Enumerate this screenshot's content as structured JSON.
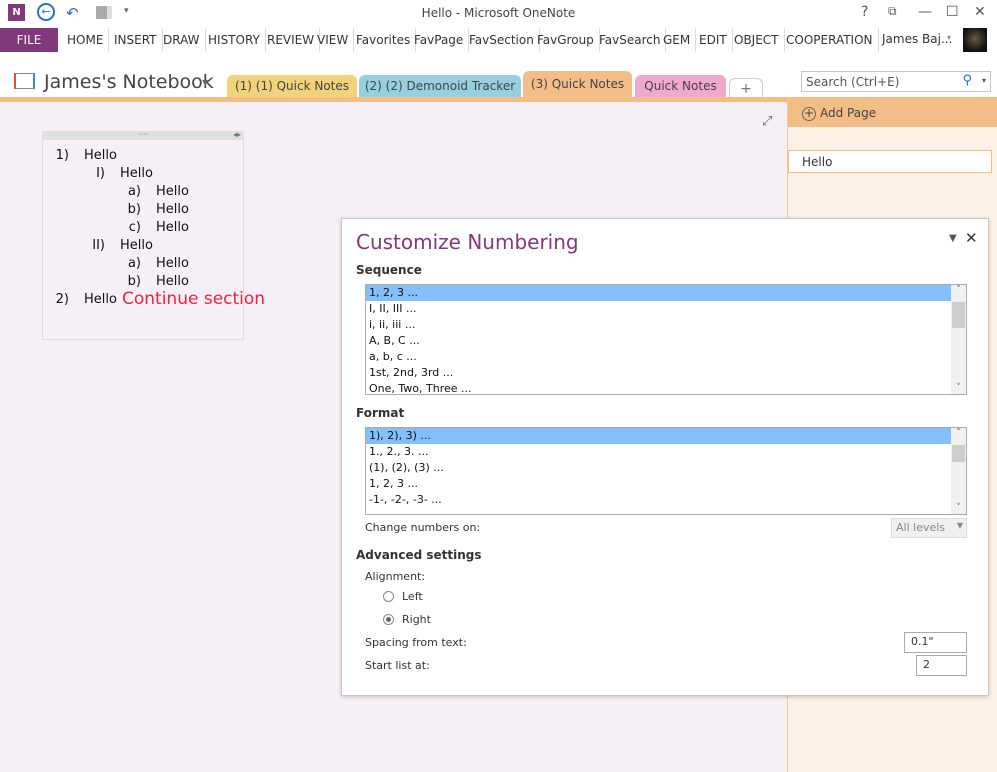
{
  "window": {
    "title": "Hello - Microsoft OneNote",
    "help": "?",
    "restore": "⧉",
    "minimize": "—",
    "maximize": "☐",
    "close": "✕"
  },
  "quick_access": {
    "app_icon": "onenote-icon",
    "back_icon": "back-icon",
    "undo_icon": "undo-icon",
    "dock_icon": "dock-icon",
    "customize": "▾"
  },
  "ribbon": {
    "tabs": [
      "FILE",
      "HOME",
      "INSERT",
      "DRAW",
      "HISTORY",
      "REVIEW",
      "VIEW",
      "Favorites",
      "FavPage",
      "FavSection",
      "FavGroup",
      "FavSearch",
      "GEM",
      "EDIT",
      "OBJECT",
      "COOPERATION"
    ],
    "user": "James Baj...",
    "user_caret": "▾"
  },
  "notebook": {
    "name": "James's Notebook",
    "caret": "▾"
  },
  "sections": [
    {
      "label": "(1) (1) Quick Notes",
      "color": "#f2d27a"
    },
    {
      "label": "(2) (2) Demonoid Tracker",
      "color": "#95cfe0"
    },
    {
      "label": "(3) Quick Notes",
      "color": "#f3bd87",
      "active": true
    },
    {
      "label": "Quick Notes",
      "color": "#f0a8d0"
    },
    {
      "label": "+"
    }
  ],
  "search": {
    "placeholder": "Search (Ctrl+E)"
  },
  "pane": {
    "add_page": "Add Page",
    "pages": [
      "Hello"
    ]
  },
  "note": {
    "items": [
      {
        "num": "1)",
        "text": "Hello",
        "level": 0
      },
      {
        "num": "I)",
        "text": "Hello",
        "level": 1
      },
      {
        "num": "a)",
        "text": "Hello",
        "level": 2
      },
      {
        "num": "b)",
        "text": "Hello",
        "level": 2
      },
      {
        "num": "c)",
        "text": "Hello",
        "level": 2
      },
      {
        "num": "II)",
        "text": "Hello",
        "level": 1
      },
      {
        "num": "a)",
        "text": "Hello",
        "level": 2
      },
      {
        "num": "b)",
        "text": "Hello",
        "level": 2
      },
      {
        "num": "2)",
        "text": "Hello",
        "level": 0
      }
    ],
    "annotation": "Continue section"
  },
  "dialog": {
    "title": "Customize Numbering",
    "sequence_label": "Sequence",
    "sequence": [
      "1, 2, 3 ...",
      "I, II, III ...",
      "i, ii, iii ...",
      "A, B, C ...",
      "a, b, c ...",
      "1st, 2nd, 3rd ...",
      "One, Two, Three ..."
    ],
    "format_label": "Format",
    "formats": [
      "1), 2), 3) ...",
      "1., 2., 3. ...",
      "(1), (2), (3) ...",
      "1, 2, 3 ...",
      "-1-, -2-, -3- ..."
    ],
    "change_numbers_label": "Change numbers on:",
    "change_numbers_value": "All levels",
    "advanced_label": "Advanced settings",
    "alignment_label": "Alignment:",
    "align_left": "Left",
    "align_right": "Right",
    "alignment_selected": "Right",
    "spacing_label": "Spacing from text:",
    "spacing_value": "0.1\"",
    "start_label": "Start list at:",
    "start_value": "2"
  }
}
